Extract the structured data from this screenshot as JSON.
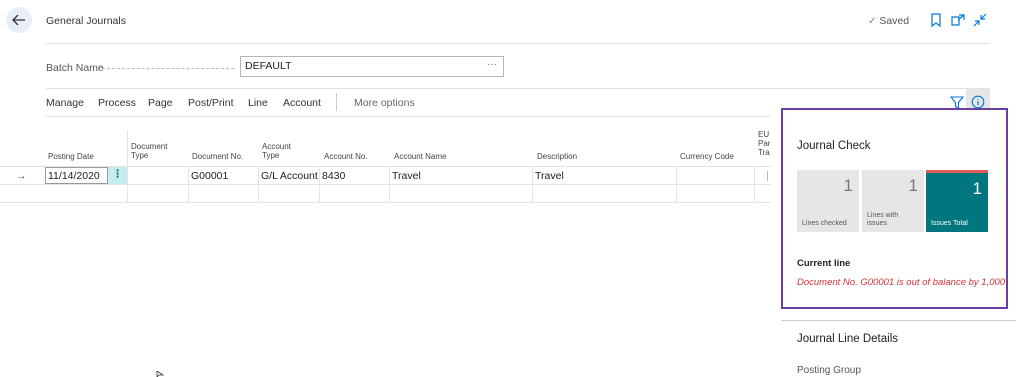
{
  "header": {
    "title": "General Journals",
    "saved_label": "Saved"
  },
  "batch": {
    "label": "Batch Name",
    "value": "DEFAULT",
    "ellipsis": "···"
  },
  "actions": {
    "items": [
      "Manage",
      "Process",
      "Page",
      "Post/Print",
      "Line",
      "Account"
    ],
    "more": "More options"
  },
  "table": {
    "columns": {
      "posting_date": "Posting Date",
      "document_type": "Document Type",
      "document_no": "Document No.",
      "account_type": "Account Type",
      "account_no": "Account No.",
      "account_name": "Account Name",
      "description": "Description",
      "currency_code": "Currency Code",
      "eu_party": "EU Par Tra"
    },
    "row": {
      "posting_date": "11/14/2020",
      "document_type": "",
      "document_no": "G00001",
      "account_type": "G/L Account",
      "account_no": "8430",
      "account_name": "Travel",
      "description": "Travel",
      "currency_code": ""
    }
  },
  "journal_check": {
    "title": "Journal Check",
    "tiles": [
      {
        "value": "1",
        "label": "Lines checked"
      },
      {
        "value": "1",
        "label": "Lines with issues"
      },
      {
        "value": "1",
        "label": "Issues Total"
      }
    ],
    "current_line_label": "Current line",
    "current_line_message": "Document No. G00001 is out of balance by 1,000"
  },
  "details": {
    "title": "Journal Line Details",
    "posting_group_label": "Posting Group"
  },
  "colors": {
    "accent": "#00777f",
    "error": "#d13438",
    "highlight_border": "#6b3fa0"
  }
}
